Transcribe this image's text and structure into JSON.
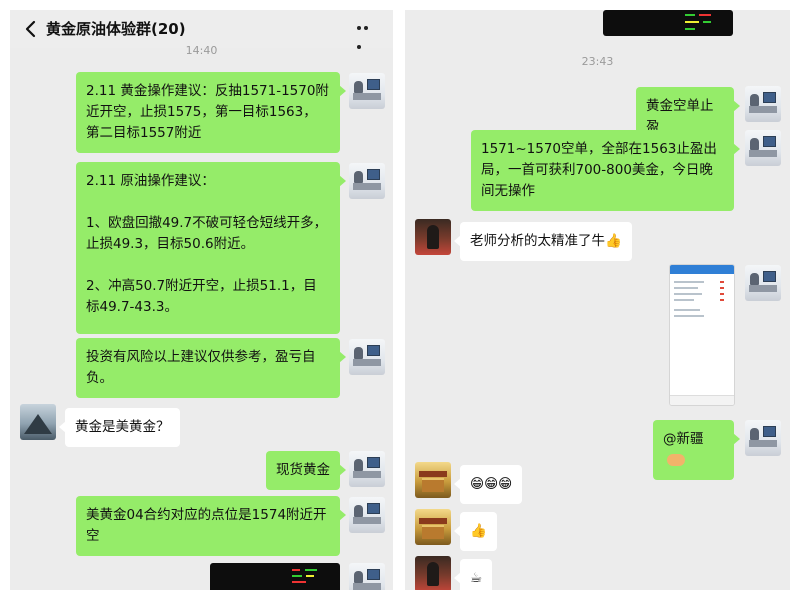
{
  "left": {
    "header": {
      "title": "黄金原油体验群(20)"
    },
    "time": "14:40",
    "messages": [
      "2.11 黄金操作建议：反抽1571-1570附近开空，止损1575，第一目标1563，第二目标1557附近",
      "2.11 原油操作建议：",
      "1、欧盘回撤49.7不破可轻仓短线开多，止损49.3，目标50.6附近。",
      "2、冲高50.7附近开空，止损51.1，目标49.7-43.3。",
      "投资有风险以上建议仅供参考，盈亏自负。",
      "黄金是美黄金？",
      "现货黄金",
      "美黄金04合约对应的点位是1574附近开空"
    ]
  },
  "right": {
    "time": "23:43",
    "messages": [
      "黄金空单止盈",
      "1571~1570空单，全部在1563止盈出局，一首可获利700-800美金，今日晚间无操作",
      "老师分析的太精准了牛",
      "@新疆"
    ],
    "emoji": {
      "thumbs_up": "👍",
      "grin_row": "😁😁😁",
      "coffee": "☕"
    }
  },
  "icons": {
    "back": "chevron-left-icon",
    "more": "more-dots-icon"
  },
  "colors": {
    "chat_bg": "#ececec",
    "my_bubble": "#95ec69",
    "other_bubble": "#ffffff"
  }
}
